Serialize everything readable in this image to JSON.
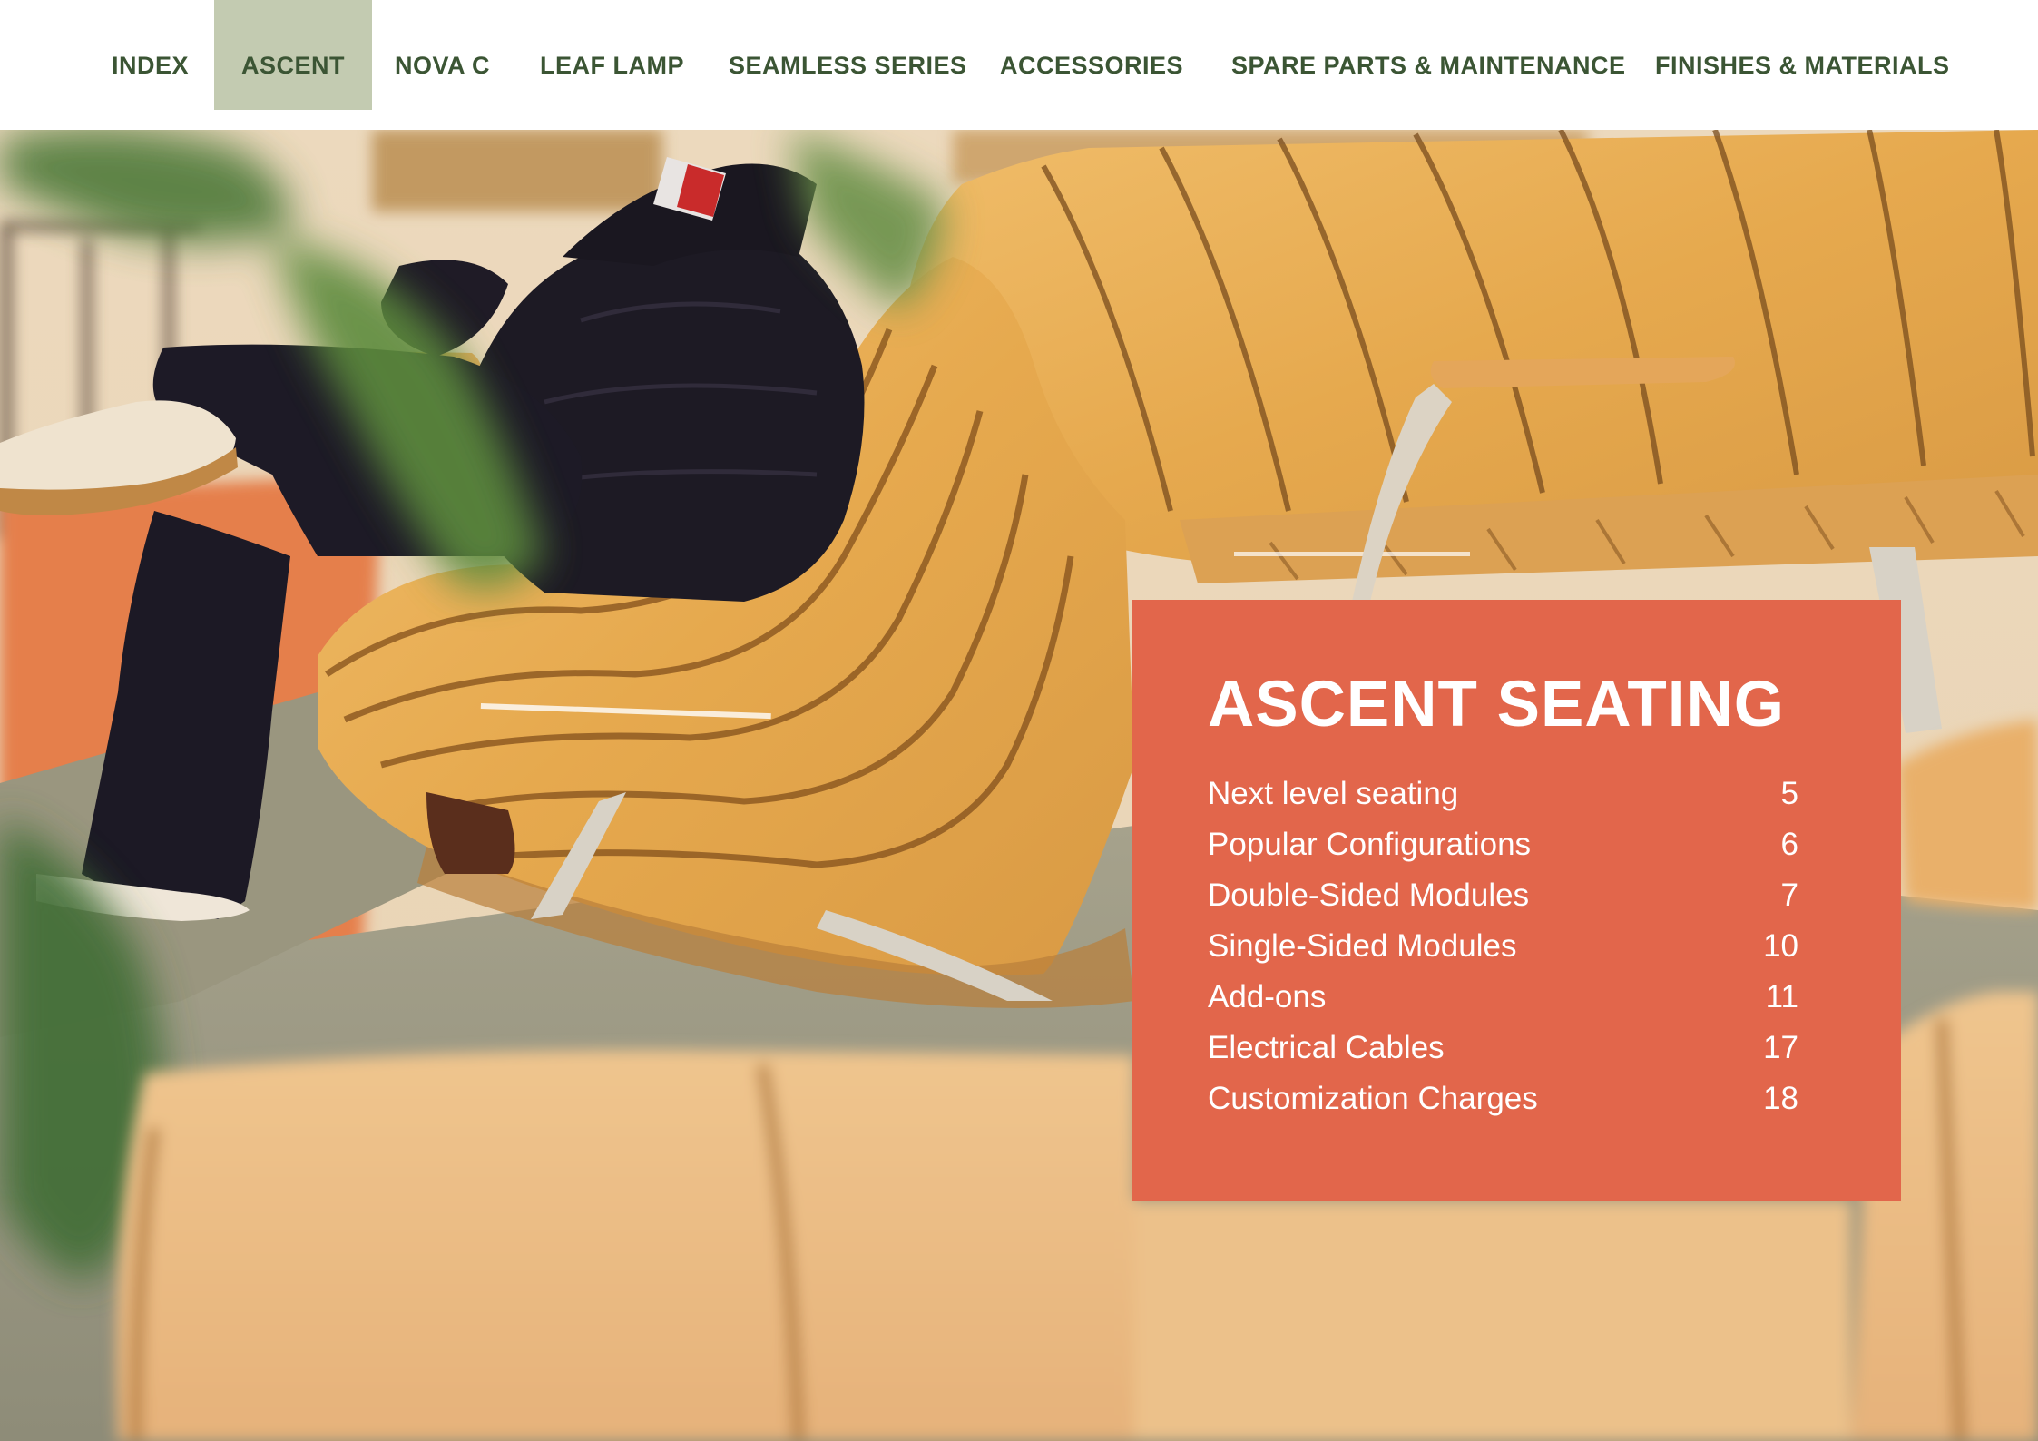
{
  "nav": {
    "items": [
      {
        "label": "INDEX"
      },
      {
        "label": "ASCENT",
        "active": true
      },
      {
        "label": "NOVA C"
      },
      {
        "label": "LEAF LAMP"
      },
      {
        "label": "SEAMLESS SERIES"
      },
      {
        "label": "ACCESSORIES"
      },
      {
        "label": "SPARE PARTS & MAINTENANCE"
      },
      {
        "label": "FINISHES & MATERIALS"
      }
    ]
  },
  "toc": {
    "title": "ASCENT SEATING",
    "entries": [
      {
        "label": "Next level seating",
        "page": "5"
      },
      {
        "label": "Popular Configurations",
        "page": "6"
      },
      {
        "label": "Double-Sided Modules",
        "page": "7"
      },
      {
        "label": "Single-Sided Modules",
        "page": "10"
      },
      {
        "label": "Add-ons",
        "page": "11"
      },
      {
        "label": "Electrical Cables",
        "page": "17"
      },
      {
        "label": "Customization Charges",
        "page": "18"
      }
    ]
  },
  "colors": {
    "nav_text": "#3b5534",
    "nav_active_bg": "#c3cbb1",
    "card_bg": "#e2664b",
    "card_text": "#ffffff"
  }
}
